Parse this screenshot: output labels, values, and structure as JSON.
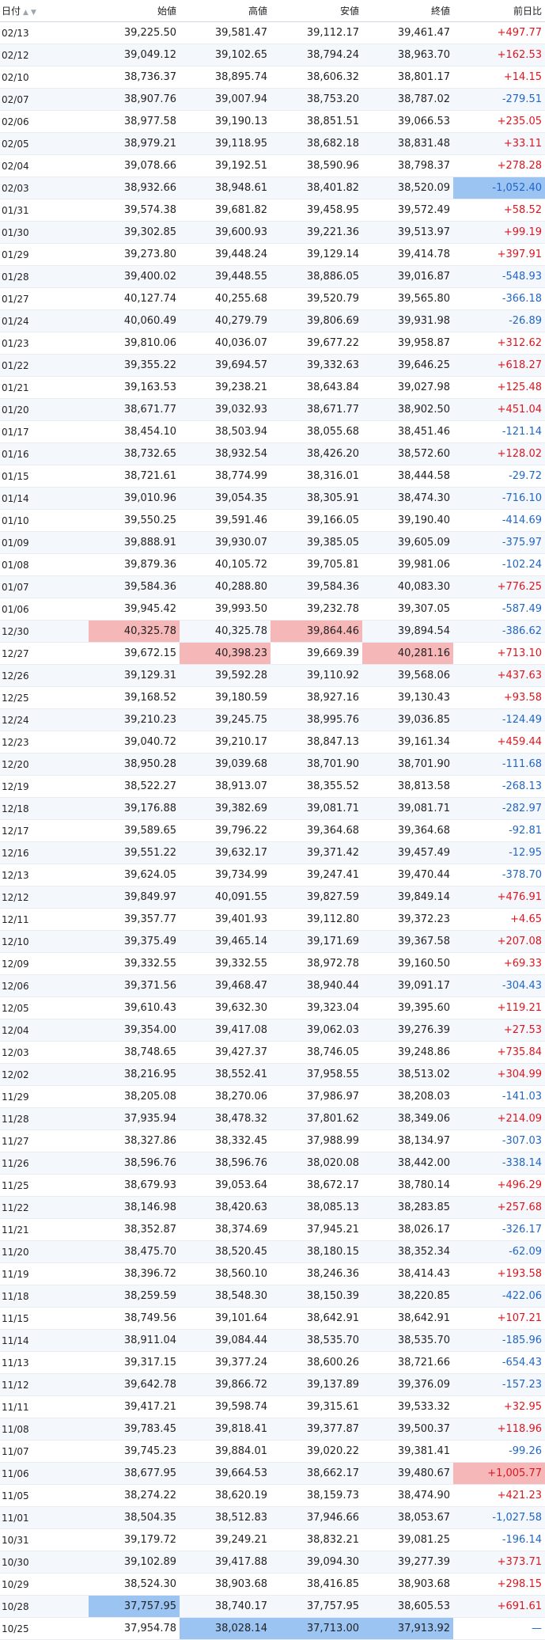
{
  "headers": {
    "date": "日付",
    "open": "始値",
    "high": "高値",
    "low": "安値",
    "close": "終値",
    "change": "前日比"
  },
  "icons": {
    "sort_up": "triangle-up-icon",
    "sort_down": "triangle-down-icon"
  },
  "colors": {
    "positive": "#e0141e",
    "negative": "#1f66c9",
    "highlight_red": "#f6b7b9",
    "highlight_blue": "#9cc4f2"
  },
  "rows": [
    {
      "date": "02/13",
      "open": "39,225.50",
      "high": "39,581.47",
      "low": "39,112.17",
      "close": "39,461.47",
      "change": "+497.77"
    },
    {
      "date": "02/12",
      "open": "39,049.12",
      "high": "39,102.65",
      "low": "38,794.24",
      "close": "38,963.70",
      "change": "+162.53"
    },
    {
      "date": "02/10",
      "open": "38,736.37",
      "high": "38,895.74",
      "low": "38,606.32",
      "close": "38,801.17",
      "change": "+14.15"
    },
    {
      "date": "02/07",
      "open": "38,907.76",
      "high": "39,007.94",
      "low": "38,753.20",
      "close": "38,787.02",
      "change": "-279.51"
    },
    {
      "date": "02/06",
      "open": "38,977.58",
      "high": "39,190.13",
      "low": "38,851.51",
      "close": "39,066.53",
      "change": "+235.05"
    },
    {
      "date": "02/05",
      "open": "38,979.21",
      "high": "39,118.95",
      "low": "38,682.18",
      "close": "38,831.48",
      "change": "+33.11"
    },
    {
      "date": "02/04",
      "open": "39,078.66",
      "high": "39,192.51",
      "low": "38,590.96",
      "close": "38,798.37",
      "change": "+278.28"
    },
    {
      "date": "02/03",
      "open": "38,932.66",
      "high": "38,948.61",
      "low": "38,401.82",
      "close": "38,520.09",
      "change": "-1,052.40",
      "hl": {
        "change": "b"
      }
    },
    {
      "date": "01/31",
      "open": "39,574.38",
      "high": "39,681.82",
      "low": "39,458.95",
      "close": "39,572.49",
      "change": "+58.52"
    },
    {
      "date": "01/30",
      "open": "39,302.85",
      "high": "39,600.93",
      "low": "39,221.36",
      "close": "39,513.97",
      "change": "+99.19"
    },
    {
      "date": "01/29",
      "open": "39,273.80",
      "high": "39,448.24",
      "low": "39,129.14",
      "close": "39,414.78",
      "change": "+397.91"
    },
    {
      "date": "01/28",
      "open": "39,400.02",
      "high": "39,448.55",
      "low": "38,886.05",
      "close": "39,016.87",
      "change": "-548.93"
    },
    {
      "date": "01/27",
      "open": "40,127.74",
      "high": "40,255.68",
      "low": "39,520.79",
      "close": "39,565.80",
      "change": "-366.18"
    },
    {
      "date": "01/24",
      "open": "40,060.49",
      "high": "40,279.79",
      "low": "39,806.69",
      "close": "39,931.98",
      "change": "-26.89"
    },
    {
      "date": "01/23",
      "open": "39,810.06",
      "high": "40,036.07",
      "low": "39,677.22",
      "close": "39,958.87",
      "change": "+312.62"
    },
    {
      "date": "01/22",
      "open": "39,355.22",
      "high": "39,694.57",
      "low": "39,332.63",
      "close": "39,646.25",
      "change": "+618.27"
    },
    {
      "date": "01/21",
      "open": "39,163.53",
      "high": "39,238.21",
      "low": "38,643.84",
      "close": "39,027.98",
      "change": "+125.48"
    },
    {
      "date": "01/20",
      "open": "38,671.77",
      "high": "39,032.93",
      "low": "38,671.77",
      "close": "38,902.50",
      "change": "+451.04"
    },
    {
      "date": "01/17",
      "open": "38,454.10",
      "high": "38,503.94",
      "low": "38,055.68",
      "close": "38,451.46",
      "change": "-121.14"
    },
    {
      "date": "01/16",
      "open": "38,732.65",
      "high": "38,932.54",
      "low": "38,426.20",
      "close": "38,572.60",
      "change": "+128.02"
    },
    {
      "date": "01/15",
      "open": "38,721.61",
      "high": "38,774.99",
      "low": "38,316.01",
      "close": "38,444.58",
      "change": "-29.72"
    },
    {
      "date": "01/14",
      "open": "39,010.96",
      "high": "39,054.35",
      "low": "38,305.91",
      "close": "38,474.30",
      "change": "-716.10"
    },
    {
      "date": "01/10",
      "open": "39,550.25",
      "high": "39,591.46",
      "low": "39,166.05",
      "close": "39,190.40",
      "change": "-414.69"
    },
    {
      "date": "01/09",
      "open": "39,888.91",
      "high": "39,930.07",
      "low": "39,385.05",
      "close": "39,605.09",
      "change": "-375.97"
    },
    {
      "date": "01/08",
      "open": "39,879.36",
      "high": "40,105.72",
      "low": "39,705.81",
      "close": "39,981.06",
      "change": "-102.24"
    },
    {
      "date": "01/07",
      "open": "39,584.36",
      "high": "40,288.80",
      "low": "39,584.36",
      "close": "40,083.30",
      "change": "+776.25"
    },
    {
      "date": "01/06",
      "open": "39,945.42",
      "high": "39,993.50",
      "low": "39,232.78",
      "close": "39,307.05",
      "change": "-587.49"
    },
    {
      "date": "12/30",
      "open": "40,325.78",
      "high": "40,325.78",
      "low": "39,864.46",
      "close": "39,894.54",
      "change": "-386.62",
      "hl": {
        "open": "r",
        "low": "r"
      }
    },
    {
      "date": "12/27",
      "open": "39,672.15",
      "high": "40,398.23",
      "low": "39,669.39",
      "close": "40,281.16",
      "change": "+713.10",
      "hl": {
        "high": "r",
        "close": "r"
      }
    },
    {
      "date": "12/26",
      "open": "39,129.31",
      "high": "39,592.28",
      "low": "39,110.92",
      "close": "39,568.06",
      "change": "+437.63"
    },
    {
      "date": "12/25",
      "open": "39,168.52",
      "high": "39,180.59",
      "low": "38,927.16",
      "close": "39,130.43",
      "change": "+93.58"
    },
    {
      "date": "12/24",
      "open": "39,210.23",
      "high": "39,245.75",
      "low": "38,995.76",
      "close": "39,036.85",
      "change": "-124.49"
    },
    {
      "date": "12/23",
      "open": "39,040.72",
      "high": "39,210.17",
      "low": "38,847.13",
      "close": "39,161.34",
      "change": "+459.44"
    },
    {
      "date": "12/20",
      "open": "38,950.28",
      "high": "39,039.68",
      "low": "38,701.90",
      "close": "38,701.90",
      "change": "-111.68"
    },
    {
      "date": "12/19",
      "open": "38,522.27",
      "high": "38,913.07",
      "low": "38,355.52",
      "close": "38,813.58",
      "change": "-268.13"
    },
    {
      "date": "12/18",
      "open": "39,176.88",
      "high": "39,382.69",
      "low": "39,081.71",
      "close": "39,081.71",
      "change": "-282.97"
    },
    {
      "date": "12/17",
      "open": "39,589.65",
      "high": "39,796.22",
      "low": "39,364.68",
      "close": "39,364.68",
      "change": "-92.81"
    },
    {
      "date": "12/16",
      "open": "39,551.22",
      "high": "39,632.17",
      "low": "39,371.42",
      "close": "39,457.49",
      "change": "-12.95"
    },
    {
      "date": "12/13",
      "open": "39,624.05",
      "high": "39,734.99",
      "low": "39,247.41",
      "close": "39,470.44",
      "change": "-378.70"
    },
    {
      "date": "12/12",
      "open": "39,849.97",
      "high": "40,091.55",
      "low": "39,827.59",
      "close": "39,849.14",
      "change": "+476.91"
    },
    {
      "date": "12/11",
      "open": "39,357.77",
      "high": "39,401.93",
      "low": "39,112.80",
      "close": "39,372.23",
      "change": "+4.65"
    },
    {
      "date": "12/10",
      "open": "39,375.49",
      "high": "39,465.14",
      "low": "39,171.69",
      "close": "39,367.58",
      "change": "+207.08"
    },
    {
      "date": "12/09",
      "open": "39,332.55",
      "high": "39,332.55",
      "low": "38,972.78",
      "close": "39,160.50",
      "change": "+69.33"
    },
    {
      "date": "12/06",
      "open": "39,371.56",
      "high": "39,468.47",
      "low": "38,940.44",
      "close": "39,091.17",
      "change": "-304.43"
    },
    {
      "date": "12/05",
      "open": "39,610.43",
      "high": "39,632.30",
      "low": "39,323.04",
      "close": "39,395.60",
      "change": "+119.21"
    },
    {
      "date": "12/04",
      "open": "39,354.00",
      "high": "39,417.08",
      "low": "39,062.03",
      "close": "39,276.39",
      "change": "+27.53"
    },
    {
      "date": "12/03",
      "open": "38,748.65",
      "high": "39,427.37",
      "low": "38,746.05",
      "close": "39,248.86",
      "change": "+735.84"
    },
    {
      "date": "12/02",
      "open": "38,216.95",
      "high": "38,552.41",
      "low": "37,958.55",
      "close": "38,513.02",
      "change": "+304.99"
    },
    {
      "date": "11/29",
      "open": "38,205.08",
      "high": "38,270.06",
      "low": "37,986.97",
      "close": "38,208.03",
      "change": "-141.03"
    },
    {
      "date": "11/28",
      "open": "37,935.94",
      "high": "38,478.32",
      "low": "37,801.62",
      "close": "38,349.06",
      "change": "+214.09"
    },
    {
      "date": "11/27",
      "open": "38,327.86",
      "high": "38,332.45",
      "low": "37,988.99",
      "close": "38,134.97",
      "change": "-307.03"
    },
    {
      "date": "11/26",
      "open": "38,596.76",
      "high": "38,596.76",
      "low": "38,020.08",
      "close": "38,442.00",
      "change": "-338.14"
    },
    {
      "date": "11/25",
      "open": "38,679.93",
      "high": "39,053.64",
      "low": "38,672.17",
      "close": "38,780.14",
      "change": "+496.29"
    },
    {
      "date": "11/22",
      "open": "38,146.98",
      "high": "38,420.63",
      "low": "38,085.13",
      "close": "38,283.85",
      "change": "+257.68"
    },
    {
      "date": "11/21",
      "open": "38,352.87",
      "high": "38,374.69",
      "low": "37,945.21",
      "close": "38,026.17",
      "change": "-326.17"
    },
    {
      "date": "11/20",
      "open": "38,475.70",
      "high": "38,520.45",
      "low": "38,180.15",
      "close": "38,352.34",
      "change": "-62.09"
    },
    {
      "date": "11/19",
      "open": "38,396.72",
      "high": "38,560.10",
      "low": "38,246.36",
      "close": "38,414.43",
      "change": "+193.58"
    },
    {
      "date": "11/18",
      "open": "38,259.59",
      "high": "38,548.30",
      "low": "38,150.39",
      "close": "38,220.85",
      "change": "-422.06"
    },
    {
      "date": "11/15",
      "open": "38,749.56",
      "high": "39,101.64",
      "low": "38,642.91",
      "close": "38,642.91",
      "change": "+107.21"
    },
    {
      "date": "11/14",
      "open": "38,911.04",
      "high": "39,084.44",
      "low": "38,535.70",
      "close": "38,535.70",
      "change": "-185.96"
    },
    {
      "date": "11/13",
      "open": "39,317.15",
      "high": "39,377.24",
      "low": "38,600.26",
      "close": "38,721.66",
      "change": "-654.43"
    },
    {
      "date": "11/12",
      "open": "39,642.78",
      "high": "39,866.72",
      "low": "39,137.89",
      "close": "39,376.09",
      "change": "-157.23"
    },
    {
      "date": "11/11",
      "open": "39,417.21",
      "high": "39,598.74",
      "low": "39,315.61",
      "close": "39,533.32",
      "change": "+32.95"
    },
    {
      "date": "11/08",
      "open": "39,783.45",
      "high": "39,818.41",
      "low": "39,377.87",
      "close": "39,500.37",
      "change": "+118.96"
    },
    {
      "date": "11/07",
      "open": "39,745.23",
      "high": "39,884.01",
      "low": "39,020.22",
      "close": "39,381.41",
      "change": "-99.26"
    },
    {
      "date": "11/06",
      "open": "38,677.95",
      "high": "39,664.53",
      "low": "38,662.17",
      "close": "39,480.67",
      "change": "+1,005.77",
      "hl": {
        "change": "r"
      }
    },
    {
      "date": "11/05",
      "open": "38,274.22",
      "high": "38,620.19",
      "low": "38,159.73",
      "close": "38,474.90",
      "change": "+421.23"
    },
    {
      "date": "11/01",
      "open": "38,504.35",
      "high": "38,512.83",
      "low": "37,946.66",
      "close": "38,053.67",
      "change": "-1,027.58"
    },
    {
      "date": "10/31",
      "open": "39,179.72",
      "high": "39,249.21",
      "low": "38,832.21",
      "close": "39,081.25",
      "change": "-196.14"
    },
    {
      "date": "10/30",
      "open": "39,102.89",
      "high": "39,417.88",
      "low": "39,094.30",
      "close": "39,277.39",
      "change": "+373.71"
    },
    {
      "date": "10/29",
      "open": "38,524.30",
      "high": "38,903.68",
      "low": "38,416.85",
      "close": "38,903.68",
      "change": "+298.15"
    },
    {
      "date": "10/28",
      "open": "37,757.95",
      "high": "38,740.17",
      "low": "37,757.95",
      "close": "38,605.53",
      "change": "+691.61",
      "hl": {
        "open": "b"
      }
    },
    {
      "date": "10/25",
      "open": "37,954.78",
      "high": "38,028.14",
      "low": "37,713.00",
      "close": "37,913.92",
      "change": "—",
      "hl": {
        "high": "b",
        "low": "b",
        "close": "b"
      }
    }
  ]
}
